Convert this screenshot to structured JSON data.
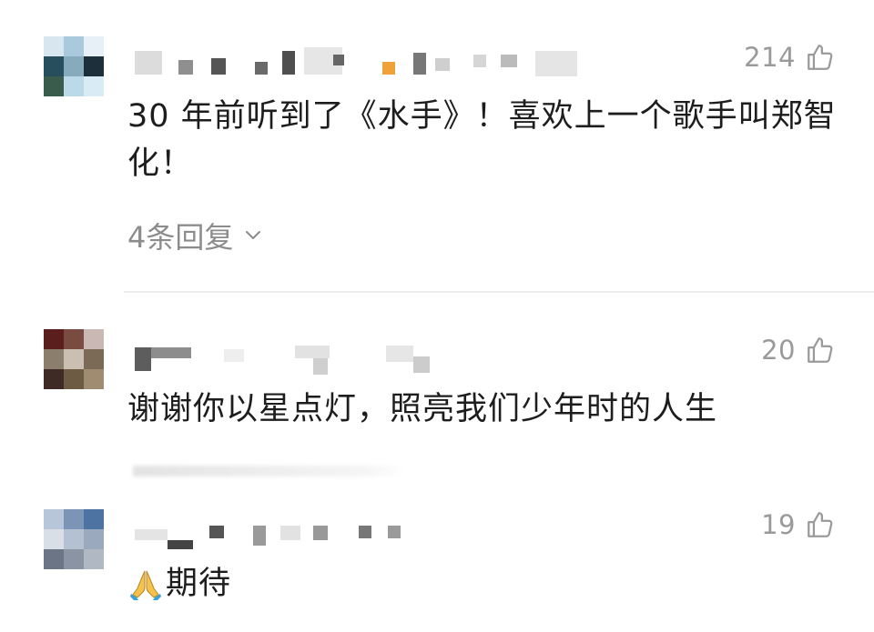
{
  "comments": [
    {
      "likes": "214",
      "text": "30 年前听到了《水手》！喜欢上一个歌手叫郑智化！",
      "replies": "4条回复"
    },
    {
      "likes": "20",
      "text": "谢谢你以星点灯，照亮我们少年时的人生"
    },
    {
      "likes": "19",
      "text": "期待"
    }
  ],
  "icons": {
    "like": "thumbs-up-icon",
    "replies_chevron": "chevron-down-icon",
    "emoji": "folded-hands-emoji"
  },
  "colors": {
    "text": "#1d1d1d",
    "meta": "#9a9a9a",
    "divider": "#ececec"
  }
}
